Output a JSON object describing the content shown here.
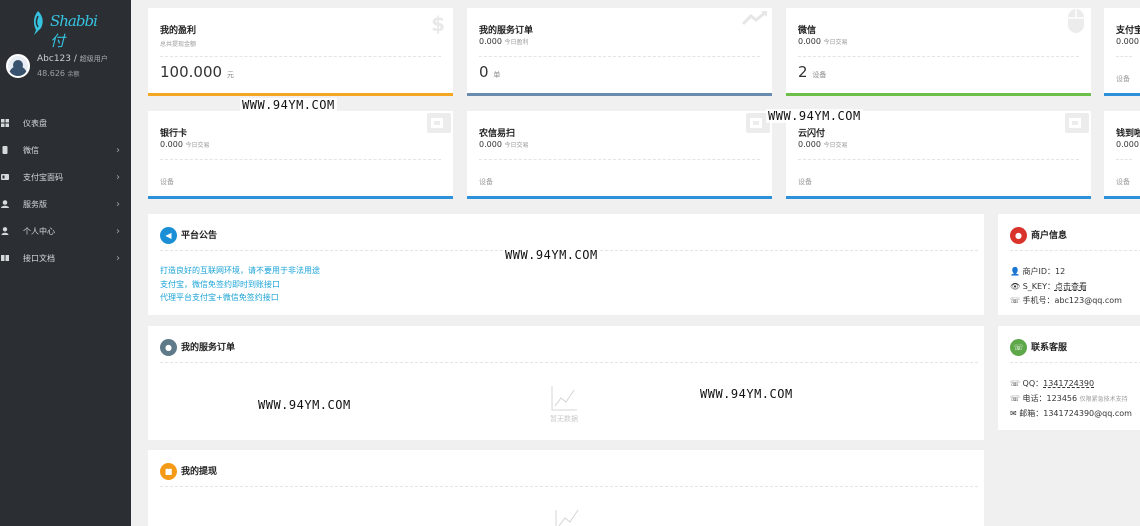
{
  "sidebar": {
    "logo_text": "Shabbi付",
    "user": {
      "name": "Abc123 / ",
      "role": "超级用户",
      "balance": "48.626",
      "balance_unit": "余额"
    },
    "menu": [
      {
        "label": "仪表盘",
        "icon": "dashboard-icon",
        "has_children": false
      },
      {
        "label": "微信",
        "icon": "wechat-icon",
        "has_children": true
      },
      {
        "label": "支付宝面码",
        "icon": "alipay-icon",
        "has_children": true
      },
      {
        "label": "服务版",
        "icon": "service-icon",
        "has_children": true
      },
      {
        "label": "个人中心",
        "icon": "user-icon",
        "has_children": true
      },
      {
        "label": "接口文档",
        "icon": "doc-icon",
        "has_children": true
      }
    ],
    "chevron": "›"
  },
  "cards": [
    {
      "title": "我的盈利",
      "note": "总共提现金额",
      "big": "100.000",
      "big_unit": "元",
      "color": "#f5a623"
    },
    {
      "title": "我的服务订单",
      "value": "0.000",
      "value_note": "今日盈利",
      "big": "0",
      "big_unit": "单",
      "color": "#6a8bb0"
    },
    {
      "title": "微信",
      "value": "0.000",
      "value_note": "今日交易",
      "big": "2",
      "big_unit": "设备",
      "color": "#6cc04a"
    },
    {
      "title": "支付宝",
      "value": "0.000",
      "value_note": "",
      "small": "设备",
      "color": "#2e90d9"
    },
    {
      "title": "银行卡",
      "value": "0.000",
      "value_note": "今日交易",
      "small": "设备",
      "color": "#2e90d9"
    },
    {
      "title": "农信易扫",
      "value": "0.000",
      "value_note": "今日交易",
      "small": "设备",
      "color": "#2e90d9"
    },
    {
      "title": "云闪付",
      "value": "0.000",
      "value_note": "今日交易",
      "small": "设备",
      "color": "#2e90d9"
    },
    {
      "title": "钱到啦",
      "value": "0.000",
      "value_note": "",
      "small": "设备",
      "color": "#2e90d9"
    }
  ],
  "notice_panel": {
    "title": "平台公告",
    "lines": [
      "打造良好的互联网环境，请不要用于非法用途",
      "支付宝，微信免签约即时到账接口",
      "代理平台支付宝+微信免签约接口"
    ]
  },
  "orders_panel": {
    "title": "我的服务订单",
    "empty_text": "暂无数据"
  },
  "withdraw_panel": {
    "title": "我的提现"
  },
  "merchant_panel": {
    "title": "商户信息",
    "merchant_id": "商户ID：12",
    "skey_label": "S_KEY：",
    "skey_link": "点击查看",
    "phone": "手机号：abc123@qq.com"
  },
  "contact_panel": {
    "title": "联系客服",
    "qq_label": "QQ：",
    "qq": "1341724390",
    "tel_label": "电话：",
    "tel": "123456",
    "tel_note": "仅限紧急技术支持",
    "mail_label": "邮箱：",
    "mail": "1341724390@qq.com"
  },
  "watermark": "WWW.94YM.COM",
  "colors": {
    "sidebar_bg": "#2b2f33",
    "link": "#1aa3d6",
    "notice_icon": "#1a8fd6",
    "orders_icon": "#5f7a88",
    "withdraw_icon": "#f59a16",
    "merchant_icon": "#d9342b",
    "contact_icon": "#5ea84a"
  }
}
